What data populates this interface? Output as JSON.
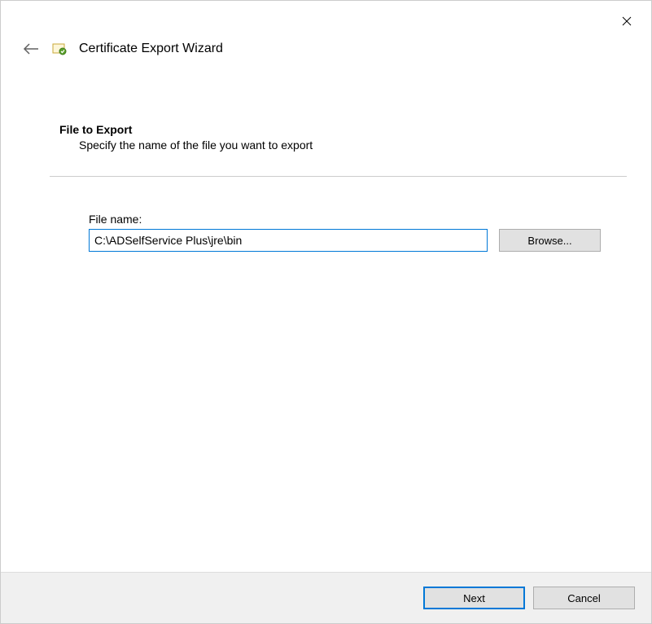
{
  "window": {
    "title": "Certificate Export Wizard"
  },
  "section": {
    "title": "File to Export",
    "description": "Specify the name of the file you want to export"
  },
  "form": {
    "filename_label": "File name:",
    "filename_value": "C:\\ADSelfService Plus\\jre\\bin",
    "browse_label": "Browse..."
  },
  "footer": {
    "next_label": "Next",
    "cancel_label": "Cancel"
  }
}
